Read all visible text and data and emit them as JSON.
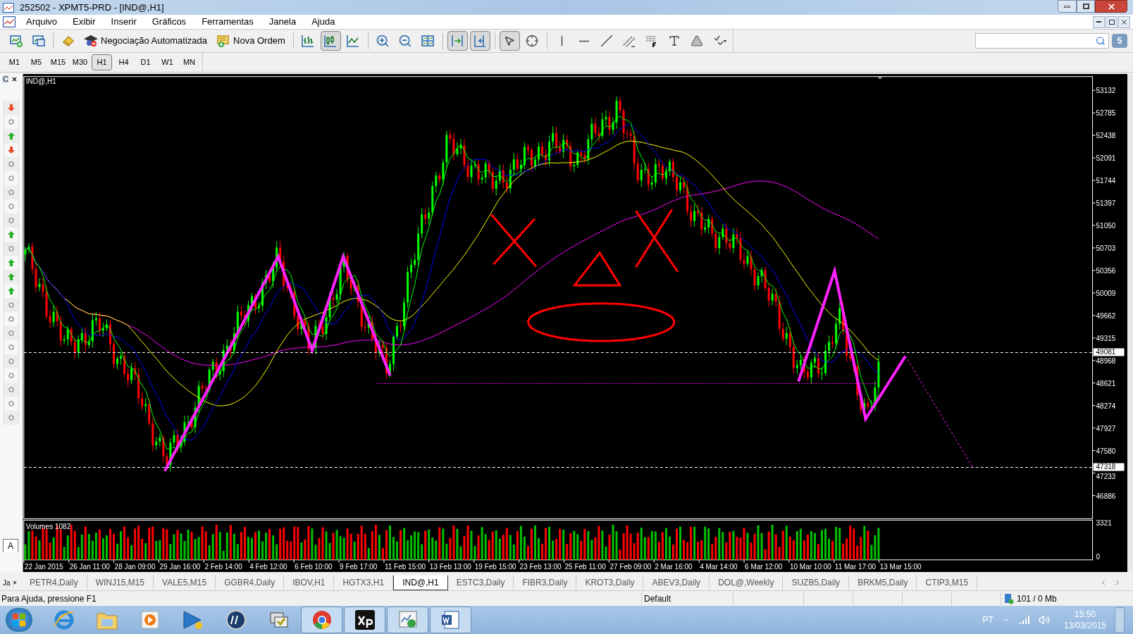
{
  "window": {
    "title": "252502 - XPMT5-PRD - [IND@,H1]"
  },
  "menu": [
    "Arquivo",
    "Exibir",
    "Inserir",
    "Gráficos",
    "Ferramentas",
    "Janela",
    "Ajuda"
  ],
  "toolbar": [
    {
      "kind": "icon",
      "pressed": false
    },
    {
      "kind": "icon",
      "pressed": false
    },
    {
      "kind": "separator"
    },
    {
      "kind": "icon",
      "pressed": false
    },
    {
      "kind": "text",
      "label": "Negociação Automatizada",
      "pressed": false
    },
    {
      "kind": "text",
      "label": "Nova Ordem",
      "pressed": false
    },
    {
      "kind": "separator"
    },
    {
      "kind": "icon",
      "pressed": false
    },
    {
      "kind": "icon",
      "pressed": true
    },
    {
      "kind": "icon",
      "pressed": false
    },
    {
      "kind": "separator"
    },
    {
      "kind": "icon",
      "pressed": false
    },
    {
      "kind": "icon",
      "pressed": false
    },
    {
      "kind": "icon",
      "pressed": false
    },
    {
      "kind": "separator"
    },
    {
      "kind": "icon",
      "pressed": true
    },
    {
      "kind": "icon",
      "pressed": true
    },
    {
      "kind": "separator"
    },
    {
      "kind": "icon",
      "pressed": true
    },
    {
      "kind": "icon",
      "pressed": false
    },
    {
      "kind": "separator"
    },
    {
      "kind": "icon",
      "pressed": false
    },
    {
      "kind": "icon",
      "pressed": false
    },
    {
      "kind": "icon",
      "pressed": false
    },
    {
      "kind": "icon",
      "pressed": false
    },
    {
      "kind": "icon",
      "pressed": false
    },
    {
      "kind": "icon",
      "pressed": false
    },
    {
      "kind": "icon",
      "pressed": false
    },
    {
      "kind": "icon",
      "pressed": false
    }
  ],
  "search": {
    "badge": "5"
  },
  "timeframes": [
    {
      "label": "M1",
      "selected": false
    },
    {
      "label": "M5",
      "selected": false
    },
    {
      "label": "M15",
      "selected": false
    },
    {
      "label": "M30",
      "selected": false
    },
    {
      "label": "H1",
      "selected": true
    },
    {
      "label": "H4",
      "selected": false
    },
    {
      "label": "D1",
      "selected": false
    },
    {
      "label": "W1",
      "selected": false
    },
    {
      "label": "MN",
      "selected": false
    }
  ],
  "sidebar": {
    "header": "C",
    "items": [
      {
        "kind": "down"
      },
      {
        "kind": "none"
      },
      {
        "kind": "up"
      },
      {
        "kind": "down"
      },
      {
        "kind": "none"
      },
      {
        "kind": "none"
      },
      {
        "kind": "none"
      },
      {
        "kind": "none"
      },
      {
        "kind": "none"
      },
      {
        "kind": "up"
      },
      {
        "kind": "none"
      },
      {
        "kind": "up"
      },
      {
        "kind": "up"
      },
      {
        "kind": "up"
      },
      {
        "kind": "none"
      },
      {
        "kind": "none"
      },
      {
        "kind": "none"
      },
      {
        "kind": "none"
      },
      {
        "kind": "none"
      },
      {
        "kind": "none"
      },
      {
        "kind": "none"
      },
      {
        "kind": "none"
      },
      {
        "kind": "none"
      }
    ],
    "bottom_tab": "A"
  },
  "chart": {
    "title": "IND@,H1",
    "volume_title": "Volumes 1082",
    "price_labels": [
      "53132",
      "52785",
      "52438",
      "52091",
      "51744",
      "51397",
      "51050",
      "50703",
      "50356",
      "50009",
      "49662",
      "49315",
      "48968",
      "48621",
      "48274",
      "47927",
      "47580",
      "47233",
      "46886"
    ],
    "price_markers": [
      "49081",
      "47318"
    ],
    "volume_labels": [
      "3321",
      "0"
    ],
    "time_labels": [
      "22 Jan 2015",
      "26 Jan 11:00",
      "28 Jan 09:00",
      "29 Jan 16:00",
      "2 Feb 14:00",
      "4 Feb 12:00",
      "6 Feb 10:00",
      "9 Feb 17:00",
      "11 Feb 15:00",
      "13 Feb 13:00",
      "19 Feb 15:00",
      "23 Feb 13:00",
      "25 Feb 11:00",
      "27 Feb 09:00",
      "2 Mar 16:00",
      "4 Mar 14:00",
      "6 Mar 12:00",
      "10 Mar 10:00",
      "11 Mar 17:00",
      "13 Mar 15:00"
    ]
  },
  "panel_tab": "Ja",
  "tabs": [
    {
      "label": "PETR4,Daily",
      "selected": false
    },
    {
      "label": "WINJ15,M15",
      "selected": false
    },
    {
      "label": "VALE5,M15",
      "selected": false
    },
    {
      "label": "GGBR4,Daily",
      "selected": false
    },
    {
      "label": "IBOV,H1",
      "selected": false
    },
    {
      "label": "HGTX3,H1",
      "selected": false
    },
    {
      "label": "IND@,H1",
      "selected": true
    },
    {
      "label": "ESTC3,Daily",
      "selected": false
    },
    {
      "label": "FIBR3,Daily",
      "selected": false
    },
    {
      "label": "KROT3,Daily",
      "selected": false
    },
    {
      "label": "ABEV3,Daily",
      "selected": false
    },
    {
      "label": "DOL@,Weekly",
      "selected": false
    },
    {
      "label": "SUZB5,Daily",
      "selected": false
    },
    {
      "label": "BRKM5,Daily",
      "selected": false
    },
    {
      "label": "CTIP3,M15",
      "selected": false
    }
  ],
  "status_bar": {
    "help": "Para Ajuda, pressione F1",
    "profile": "Default",
    "traffic": "101 / 0 Mb"
  },
  "taskbar": {
    "apps": [
      {
        "kind": "browser",
        "open": false
      },
      {
        "kind": "folder",
        "open": false
      },
      {
        "kind": "media",
        "open": false
      },
      {
        "kind": "flag",
        "open": false
      },
      {
        "kind": "hp",
        "open": false
      },
      {
        "kind": "sync",
        "open": false
      },
      {
        "kind": "chrome",
        "open": true
      },
      {
        "kind": "xp",
        "open": true
      },
      {
        "kind": "terminal",
        "open": true
      },
      {
        "kind": "word",
        "open": true
      }
    ],
    "language": "PT",
    "time": "15:50",
    "date": "13/03/2015"
  }
}
